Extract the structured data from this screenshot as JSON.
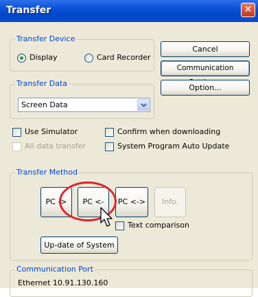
{
  "window": {
    "title": "Transfer"
  },
  "transfer_device": {
    "legend": "Transfer Device",
    "options": [
      {
        "label": "Display",
        "selected": true
      },
      {
        "label": "Card Recorder",
        "selected": false
      }
    ]
  },
  "buttons": {
    "cancel": "Cancel",
    "communication_setting": "Communication Setting...",
    "option": "Option..."
  },
  "transfer_data": {
    "legend": "Transfer Data",
    "selected": "Screen Data"
  },
  "checkboxes": {
    "use_simulator": "Use Simulator",
    "all_data_transfer": "All data transfer",
    "confirm_when_downloading": "Confirm when downloading",
    "system_program_auto_update": "System Program Auto Update"
  },
  "transfer_method": {
    "legend": "Transfer Method",
    "pc_to": "PC ->",
    "pc_from": "PC <-",
    "pc_compare": "PC <->",
    "info": "Info.",
    "text_comparison": "Text comparison",
    "update_system": "Up-date of System"
  },
  "communication_port": {
    "legend": "Communication Port",
    "value": "Ethernet 10.91.130.160"
  },
  "colors": {
    "annotation": "#e0232e",
    "title_bar": "#0a52d8",
    "legend_text": "#0046d5"
  }
}
